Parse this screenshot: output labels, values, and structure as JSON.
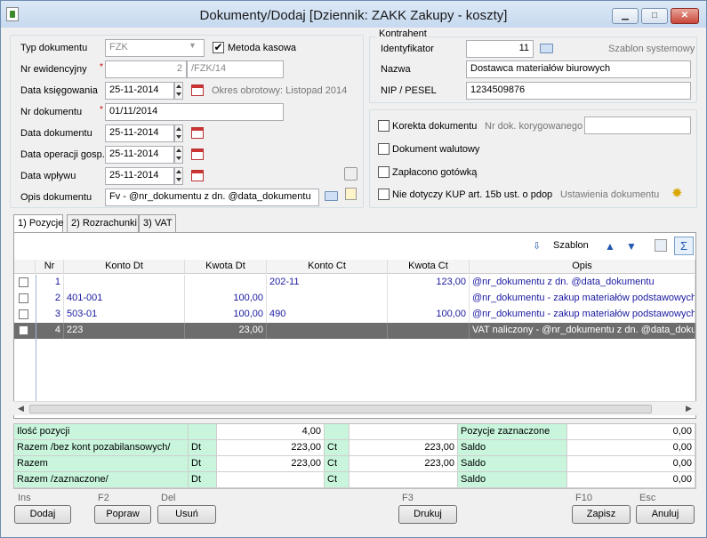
{
  "window": {
    "title": "Dokumenty/Dodaj [Dziennik: ZAKK  Zakupy - koszty]",
    "min": "▁",
    "max": "□",
    "close": "✕"
  },
  "form": {
    "typ_label": "Typ dokumentu",
    "typ_value": "FZK",
    "metoda_label": "Metoda kasowa",
    "metoda_checked": "✔",
    "nr_ew_label": "Nr ewidencyjny",
    "nr_ew_value": "2",
    "nr_ew_suffix": "/FZK/14",
    "data_ksieg_label": "Data księgowania",
    "data_ksieg_value": "25-11-2014",
    "okres_label": "Okres obrotowy: Listopad 2014",
    "nr_dok_label": "Nr dokumentu",
    "nr_dok_value": "01/11/2014",
    "data_dok_label": "Data dokumentu",
    "data_dok_value": "25-11-2014",
    "data_oper_label": "Data operacji gosp.",
    "data_oper_value": "25-11-2014",
    "data_wplywu_label": "Data wpływu",
    "data_wplywu_value": "25-11-2014",
    "opis_label": "Opis dokumentu",
    "opis_value": "Fv - @nr_dokumentu z dn. @data_dokumentu",
    "required_mark": "*"
  },
  "kontrahent": {
    "group_label": "Kontrahent",
    "ident_label": "Identyfikator",
    "ident_value": "11",
    "szablon_label": "Szablon systemowy",
    "nazwa_label": "Nazwa",
    "nazwa_value": "Dostawca materiałów biurowych",
    "nip_label": "NIP / PESEL",
    "nip_value": "1234509876"
  },
  "options": {
    "korekta_label": "Korekta dokumentu",
    "nr_kor_label": "Nr dok. korygowanego",
    "walutowy_label": "Dokument walutowy",
    "gotowka_label": "Zapłacono gotówką",
    "kup_label": "Nie dotyczy KUP art. 15b ust. o pdop",
    "ustawienia_label": "Ustawienia dokumentu"
  },
  "tabs": [
    {
      "label": "1) Pozycje"
    },
    {
      "label": "2) Rozrachunki"
    },
    {
      "label": "3) VAT"
    }
  ],
  "toolbar": {
    "szablon_label": "Szablon",
    "sigma": "Σ"
  },
  "grid": {
    "headers": [
      "Nr",
      "Konto Dt",
      "Kwota Dt",
      "Konto Ct",
      "Kwota Ct",
      "Opis"
    ],
    "rows": [
      {
        "nr": "1",
        "konto_dt": "",
        "kwota_dt": "",
        "konto_ct": "202-11",
        "kwota_ct": "123,00",
        "opis": "@nr_dokumentu z dn. @data_dokumentu"
      },
      {
        "nr": "2",
        "konto_dt": "401-001",
        "kwota_dt": "100,00",
        "konto_ct": "",
        "kwota_ct": "",
        "opis": "@nr_dokumentu - zakup materiałów podstawowych"
      },
      {
        "nr": "3",
        "konto_dt": "503-01",
        "kwota_dt": "100,00",
        "konto_ct": "490",
        "kwota_ct": "100,00",
        "opis": "@nr_dokumentu - zakup materiałów podstawowych"
      },
      {
        "nr": "4",
        "konto_dt": "223",
        "kwota_dt": "23,00",
        "konto_ct": "",
        "kwota_ct": "",
        "opis": "VAT naliczony - @nr_dokumentu z dn. @data_dokumentu"
      }
    ]
  },
  "summary": {
    "rows": [
      {
        "label": "Ilość pozycji",
        "dt_lbl": "",
        "dt_val": "4,00",
        "ct_lbl": "",
        "ct_val": "",
        "r_lbl": "Pozycje zaznaczone",
        "r_val": "0,00"
      },
      {
        "label": "Razem /bez kont pozabilansowych/",
        "dt_lbl": "Dt",
        "dt_val": "223,00",
        "ct_lbl": "Ct",
        "ct_val": "223,00",
        "r_lbl": "Saldo",
        "r_val": "0,00"
      },
      {
        "label": "Razem",
        "dt_lbl": "Dt",
        "dt_val": "223,00",
        "ct_lbl": "Ct",
        "ct_val": "223,00",
        "r_lbl": "Saldo",
        "r_val": "0,00"
      },
      {
        "label": "Razem /zaznaczone/",
        "dt_lbl": "Dt",
        "dt_val": "",
        "ct_lbl": "Ct",
        "ct_val": "",
        "r_lbl": "Saldo",
        "r_val": "0,00"
      }
    ]
  },
  "buttons": {
    "dodaj": "Dodaj",
    "dodaj_key": "Ins",
    "popraw": "Popraw",
    "popraw_key": "F2",
    "usun": "Usuń",
    "usun_key": "Del",
    "drukuj": "Drukuj",
    "drukuj_key": "F3",
    "zapisz": "Zapisz",
    "zapisz_key": "F10",
    "anuluj": "Anuluj",
    "anuluj_key": "Esc"
  }
}
